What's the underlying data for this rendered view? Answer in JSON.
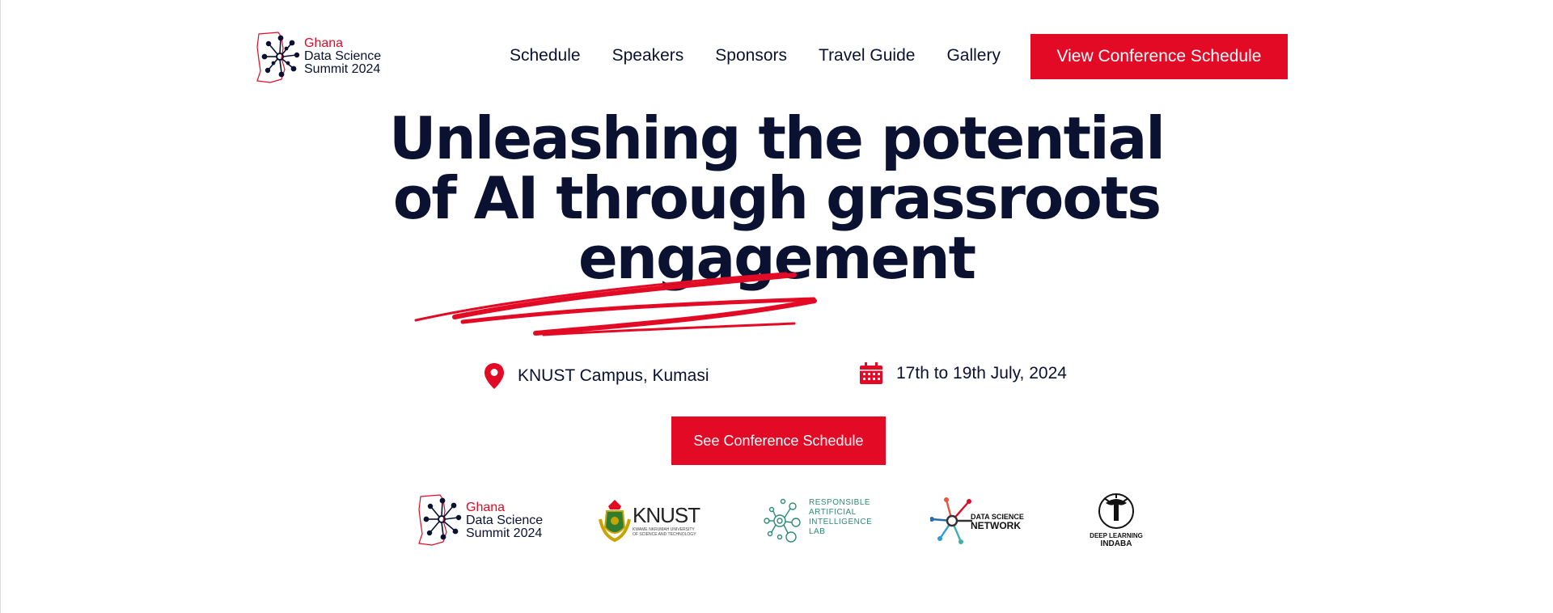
{
  "brand": {
    "line1": "Ghana",
    "line2": "Data Science",
    "line3": "Summit 2024"
  },
  "nav": {
    "items": [
      "Schedule",
      "Speakers",
      "Sponsors",
      "Travel Guide",
      "Gallery"
    ],
    "cta": "View Conference Schedule"
  },
  "hero": {
    "headline": "Unleashing the potential of AI through grassroots engagement",
    "location": "KNUST Campus, Kumasi",
    "dates": "17th to 19th July, 2024",
    "cta": "See Conference Schedule"
  },
  "partners": {
    "gdss": {
      "line1": "Ghana",
      "line2": "Data Science",
      "line3": "Summit 2024"
    },
    "knust": {
      "name": "KNUST",
      "sub1": "KWAME NKRUMAH UNIVERSITY",
      "sub2": "OF SCIENCE AND TECHNOLOGY"
    },
    "rail": {
      "l1": "RESPONSIBLE",
      "l2": "ARTIFICIAL",
      "l3": "INTELLIGENCE",
      "l4": "LAB"
    },
    "dsn": {
      "l1": "DATA SCIENCE",
      "l2": "NETWORK"
    },
    "dli": {
      "l1": "DEEP LEARNING",
      "l2": "INDABA"
    }
  },
  "colors": {
    "accent": "#e30a25",
    "navy": "#0a1131",
    "background": "#ffffff"
  },
  "icons": {
    "location": "map-pin-icon",
    "date": "calendar-icon"
  }
}
